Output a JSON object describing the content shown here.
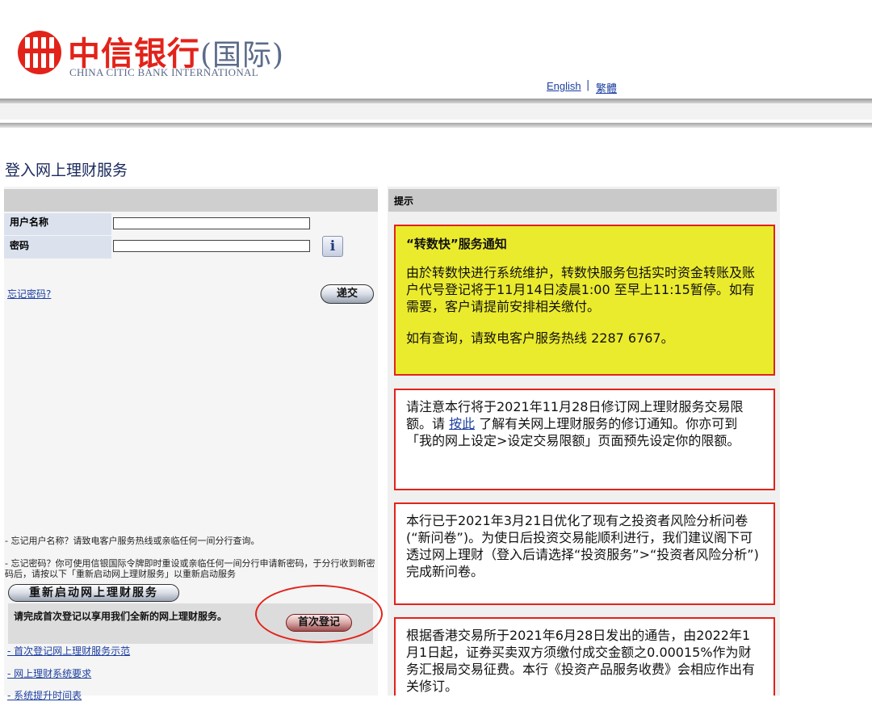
{
  "brand": {
    "name_cn": "中信银行",
    "name_cn_suffix": "(国际)",
    "name_en": "CHINA CITIC BANK INTERNATIONAL",
    "logo_color": "#e2231a"
  },
  "language_links": {
    "english": "English",
    "separator": "|",
    "traditional": "繁體"
  },
  "page_title": "登入网上理财服务",
  "login": {
    "username_label": "用户名称",
    "username_value": "",
    "password_label": "密码",
    "password_value": "",
    "info_button_label": "i",
    "forgot_password_link": "忘记密码?",
    "submit_button": "递交"
  },
  "help_notes": {
    "forgot_username": "- 忘记用户名称？请致电客户服务热线或亲临任何一间分行查询。",
    "forgot_password": "- 忘记密码？你可使用信银国际令牌即时重设或亲临任何一间分行申请新密码，于分行收到新密码后，请按以下「重新启动网上理财服务」以重新启动服务",
    "restart_button": "重新启动网上理财服务"
  },
  "first_login": {
    "message": "请完成首次登记以享用我们全新的网上理财服务。",
    "button": "首次登记"
  },
  "left_links": [
    "- 首次登记网上理财服务示范",
    "- 网上理财系统要求",
    "- 系统提升时间表"
  ],
  "tips": {
    "header": "提示",
    "notices": [
      {
        "title": "“转数快”服务通知",
        "paragraphs": [
          "由於转数快进行系统维护，转数快服务包括实时资金转账及账户代号登记将于11月14日凌晨1:00 至早上11:15暂停。如有需要，客户请提前安排相关缴付。",
          "如有查询，请致电客户服务热线 2287 6767。"
        ]
      },
      {
        "text_before_link": "请注意本行将于2021年11月28日修订网上理财服务交易限额。请 ",
        "link_text": "按此",
        "text_after_link": " 了解有关网上理财服务的修订通知。你亦可到「我的网上设定>设定交易限额」页面预先设定你的限额。"
      },
      {
        "text": "本行已于2021年3月21日优化了现有之投资者风险分析问卷(“新问卷”)。为使日后投资交易能顺利进行，我们建议阁下可透过网上理财（登入后请选择“投资服务”>“投资者风险分析”) 完成新问卷。"
      },
      {
        "text": "根据香港交易所于2021年6月28日发出的通告，由2022年1月1日起，证券买卖双方须缴付成交金额之0.00015%作为财务汇报局交易征费。本行《投资产品服务收费》会相应作出有关修订。"
      }
    ]
  }
}
